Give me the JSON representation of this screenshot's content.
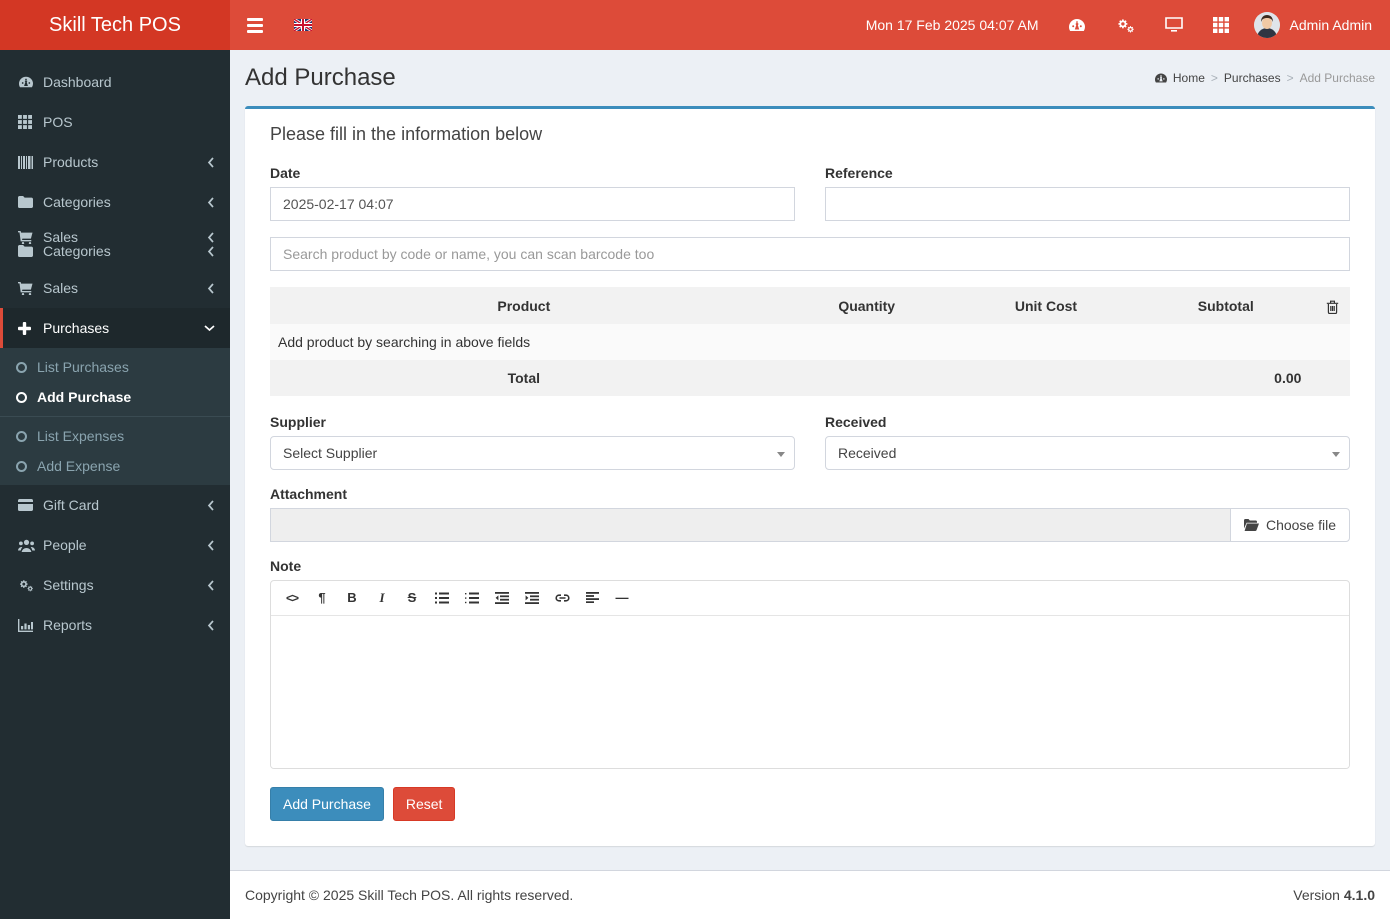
{
  "brand": {
    "title": "Skill Tech POS"
  },
  "navbar": {
    "datetime": "Mon 17 Feb 2025 04:07 AM",
    "user_name": "Admin Admin",
    "icon_names": [
      "dashboard-icon",
      "cogs-icon",
      "desktop-icon",
      "grid-icon"
    ],
    "language_flag": "uk-flag"
  },
  "sidebar": {
    "items": [
      {
        "label": "Dashboard"
      },
      {
        "label": "POS"
      },
      {
        "label": "Products"
      },
      {
        "label": "Categories"
      },
      {
        "label": "Sales"
      },
      {
        "label": "Categories"
      },
      {
        "label": "Sales"
      },
      {
        "label": "Purchases",
        "submenu": [
          {
            "label": "List Purchases"
          },
          {
            "label": "Add Purchase"
          },
          {
            "label": "List Expenses"
          },
          {
            "label": "Add Expense"
          }
        ]
      },
      {
        "label": "Gift Card"
      },
      {
        "label": "People"
      },
      {
        "label": "Settings"
      },
      {
        "label": "Reports"
      }
    ]
  },
  "page": {
    "title": "Add Purchase",
    "breadcrumb": {
      "home": "Home",
      "section": "Purchases",
      "current": "Add Purchase"
    }
  },
  "form": {
    "panel_title": "Please fill in the information below",
    "date": {
      "label": "Date",
      "value": "2025-02-17 04:07"
    },
    "reference": {
      "label": "Reference",
      "value": ""
    },
    "product_search": {
      "placeholder": "Search product by code or name, you can scan barcode too"
    },
    "order_table": {
      "headers": {
        "product": "Product",
        "quantity": "Quantity",
        "unit_cost": "Unit Cost",
        "subtotal": "Subtotal"
      },
      "empty_message": "Add product by searching in above fields",
      "total_label": "Total",
      "total_value": "0.00"
    },
    "supplier": {
      "label": "Supplier",
      "selected": "Select Supplier"
    },
    "received": {
      "label": "Received",
      "selected": "Received"
    },
    "attachment": {
      "label": "Attachment",
      "button_label": "Choose file"
    },
    "note": {
      "label": "Note",
      "toolbar_glyphs": {
        "code": "<>",
        "paragraph": "¶",
        "bold": "B",
        "italic": "I",
        "strike": "S",
        "hr": "—"
      },
      "toolbar_names": [
        "code-view",
        "paragraph",
        "bold",
        "italic",
        "strikethrough",
        "unordered-list",
        "ordered-list",
        "outdent",
        "indent",
        "link",
        "align-left",
        "horizontal-rule"
      ]
    },
    "submit_label": "Add Purchase",
    "reset_label": "Reset"
  },
  "footer": {
    "copyright": "Copyright © 2025 Skill Tech POS. All rights reserved.",
    "version_label": "Version ",
    "version": "4.1.0"
  },
  "colors": {
    "navbar": "#dd4b39",
    "brand": "#d33724",
    "sidebar": "#222d32",
    "accent": "#3c8dbc",
    "danger": "#dd4b39"
  }
}
